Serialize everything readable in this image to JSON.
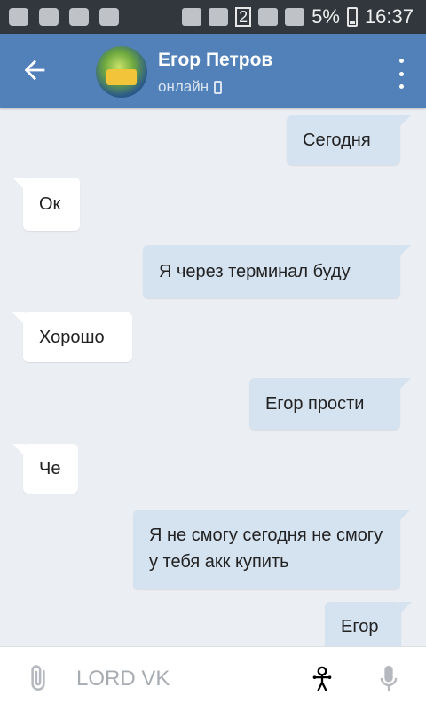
{
  "statusbar": {
    "battery": "5%",
    "time": "16:37",
    "sim_badge": "2"
  },
  "header": {
    "title": "Егор Петров",
    "status": "онлайн",
    "icons": [
      "back-arrow-icon",
      "avatar",
      "mobile-phone-icon",
      "more-vert-icon"
    ]
  },
  "messages": [
    {
      "side": "out",
      "text": "Сегодня"
    },
    {
      "side": "in",
      "text": "Ок"
    },
    {
      "side": "out",
      "text": "Я через терминал буду"
    },
    {
      "side": "in",
      "text": "Хорошо"
    },
    {
      "side": "out",
      "text": "Егор прости"
    },
    {
      "side": "in",
      "text": "Че"
    },
    {
      "side": "out",
      "text": "Я не смогу сегодня не смогу у тебя акк купить"
    },
    {
      "side": "out",
      "text": "Егор"
    }
  ],
  "composer": {
    "placeholder": "LORD VK",
    "icons": [
      "attach-icon",
      "sticker-icon",
      "mic-icon"
    ]
  },
  "colors": {
    "appbar": "#5181b8",
    "outgoing_bubble": "#d5e2f0",
    "incoming_bubble": "#ffffff",
    "chat_bg": "#ebeef3"
  }
}
